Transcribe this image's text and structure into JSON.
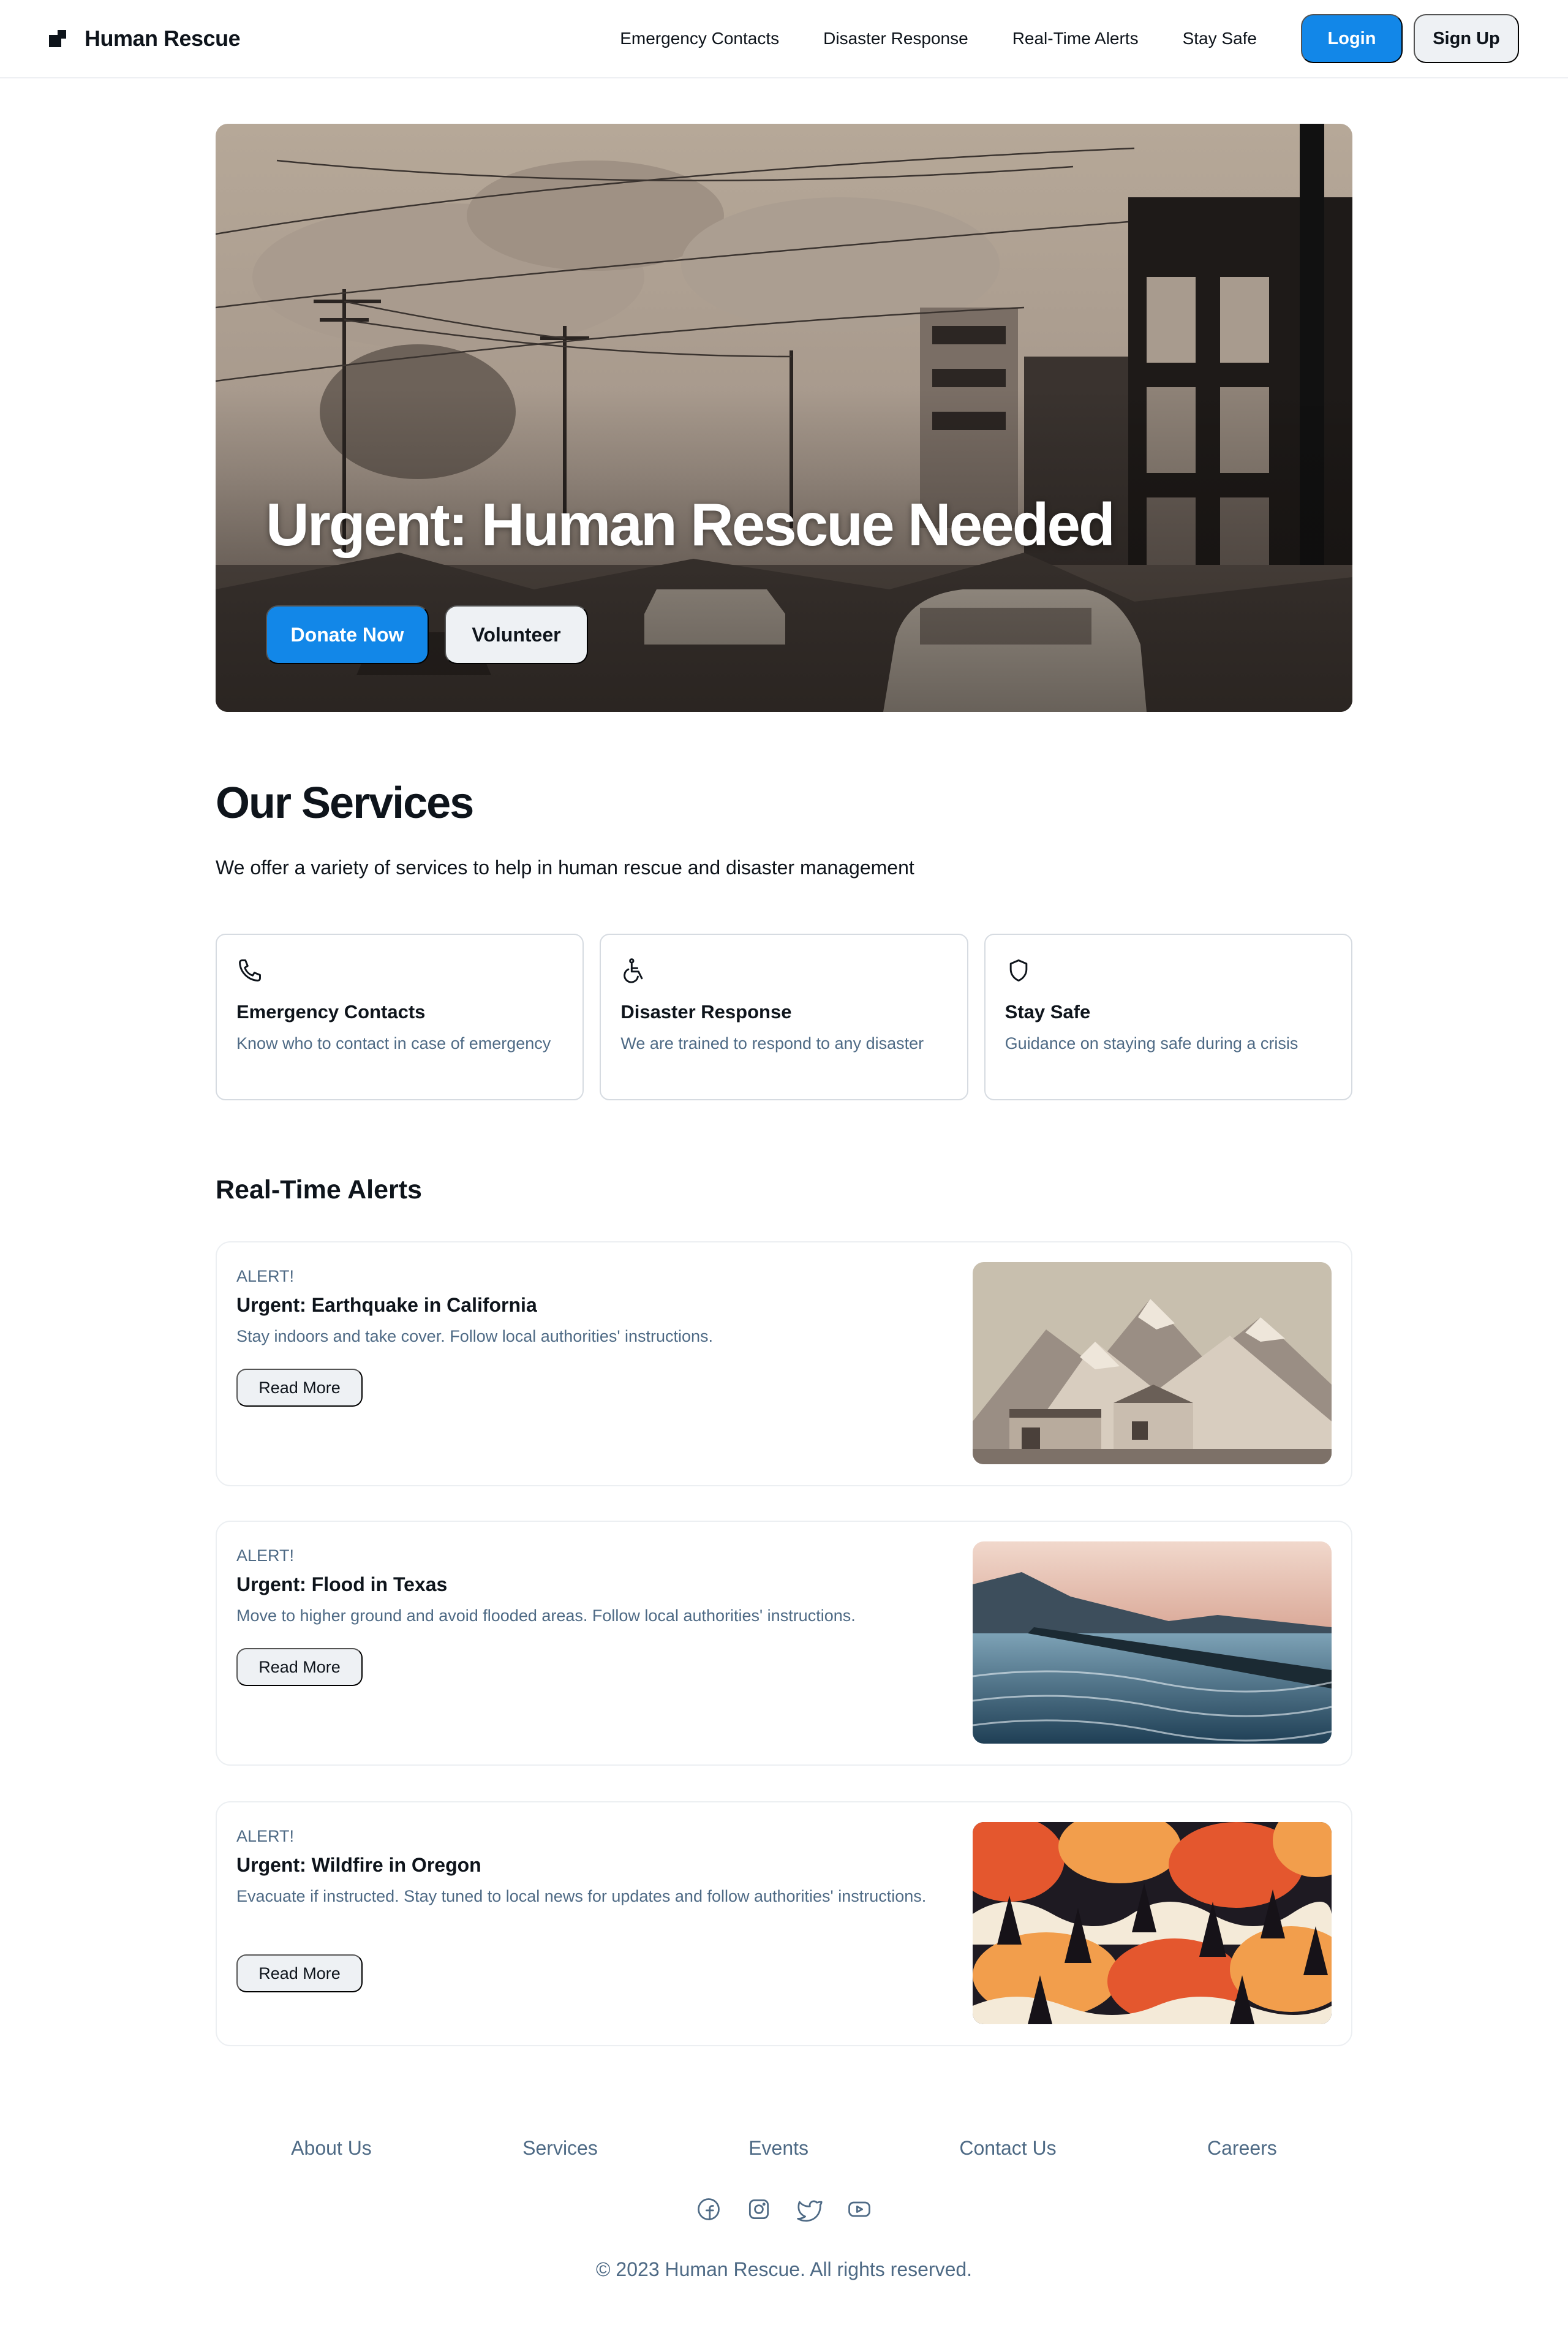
{
  "header": {
    "brand": "Human Rescue",
    "nav": [
      "Emergency Contacts",
      "Disaster Response",
      "Real-Time Alerts",
      "Stay Safe"
    ],
    "login_label": "Login",
    "signup_label": "Sign Up"
  },
  "hero": {
    "title": "Urgent: Human Rescue Needed",
    "donate_label": "Donate Now",
    "volunteer_label": "Volunteer"
  },
  "services": {
    "title": "Our Services",
    "subtitle": "We offer a variety of services to help in human rescue and disaster management",
    "cards": [
      {
        "icon": "phone-icon",
        "title": "Emergency Contacts",
        "desc": "Know who to contact in case of emergency"
      },
      {
        "icon": "wheelchair-icon",
        "title": "Disaster Response",
        "desc": "We are trained to respond to any disaster"
      },
      {
        "icon": "shield-icon",
        "title": "Stay Safe",
        "desc": "Guidance on staying safe during a crisis"
      }
    ]
  },
  "alerts": {
    "title": "Real-Time Alerts",
    "items": [
      {
        "eyebrow": "ALERT!",
        "title": "Urgent: Earthquake in California",
        "desc": "Stay indoors and take cover. Follow local authorities' instructions.",
        "cta": "Read More"
      },
      {
        "eyebrow": "ALERT!",
        "title": "Urgent: Flood in Texas",
        "desc": "Move to higher ground and avoid flooded areas. Follow local authorities' instructions.",
        "cta": "Read More"
      },
      {
        "eyebrow": "ALERT!",
        "title": "Urgent: Wildfire in Oregon",
        "desc": "Evacuate if instructed. Stay tuned to local news for updates and follow authorities' instructions.",
        "cta": "Read More"
      }
    ]
  },
  "footer": {
    "links": [
      "About Us",
      "Services",
      "Events",
      "Contact Us",
      "Careers"
    ],
    "socials": [
      "facebook-icon",
      "instagram-icon",
      "twitter-icon",
      "youtube-icon"
    ],
    "copyright": "© 2023 Human Rescue. All rights reserved."
  },
  "colors": {
    "primary": "#1287e8",
    "secondary_button": "#eef1f4",
    "muted_text": "#4e6a85",
    "text": "#0e141b"
  }
}
